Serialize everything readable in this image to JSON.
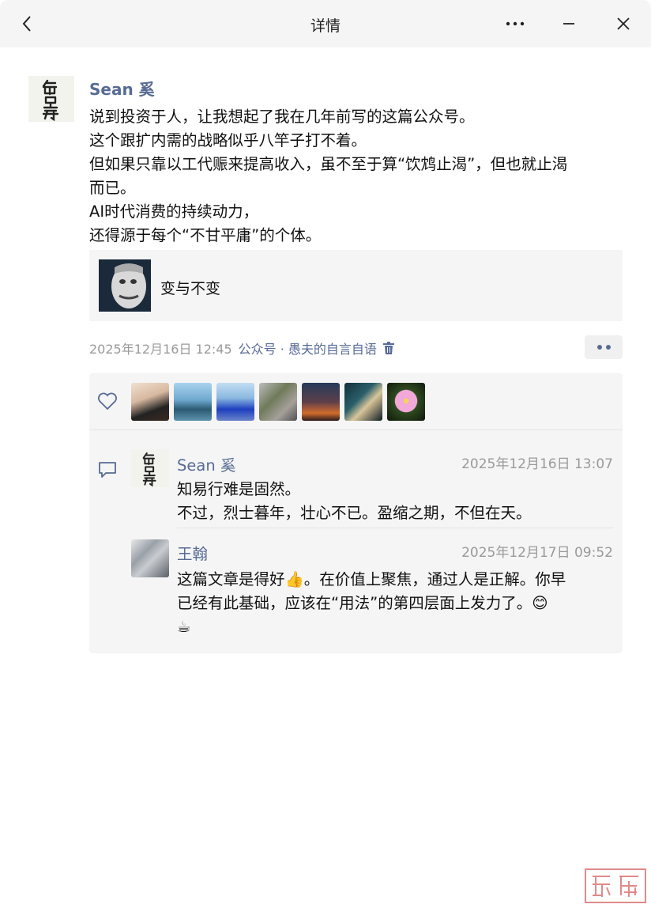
{
  "window": {
    "title": "详情",
    "icons": {
      "back": "chevron-left-icon",
      "more": "more-horizontal-icon",
      "minimize": "minimize-icon",
      "close": "close-icon"
    }
  },
  "post": {
    "author": "Sean 奚",
    "author_avatar_text": "龟虽寿",
    "lines": [
      "说到投资于人，让我想起了我在几年前写的这篇公众号。",
      "这个跟扩内需的战略似乎八竿子打不着。",
      "但如果只靠以工代赈来提高收入，虽不至于算“饮鸩止渴”，但也就止渴",
      "而已。",
      "AI时代消费的持续动力，",
      "还得源于每个“不甘平庸”的个体。"
    ],
    "link_card": {
      "title": "变与不变"
    },
    "timestamp": "2025年12月16日 12:45",
    "source": "公众号 · 愚夫的自言自语"
  },
  "likes": {
    "icon": "heart-icon",
    "count": 7
  },
  "comments": [
    {
      "name": "Sean 奚",
      "time": "2025年12月16日 13:07",
      "lines": [
        "知易行难是固然。",
        "不过，烈士暮年，壮心不已。盈缩之期，不但在天。"
      ]
    },
    {
      "name": "王翰",
      "time": "2025年12月17日 09:52",
      "lines": [
        "这篇文章是得好👍。在价值上聚焦，通过人是正解。你早",
        "已经有此基础，应该在“用法”的第四层面上发力了。😊",
        "☕"
      ]
    }
  ],
  "colors": {
    "link": "#576b95",
    "meta": "#9a9a9a",
    "panel": "#f5f5f5"
  }
}
